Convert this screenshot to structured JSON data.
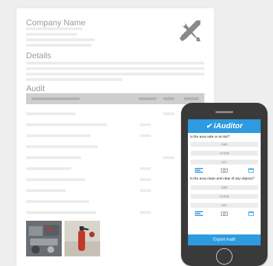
{
  "document": {
    "company_name": "Company Name",
    "details_heading": "Details",
    "audit_heading": "Audit",
    "icon_name": "tools-icon"
  },
  "phone": {
    "app_title": "iAuditor",
    "questions": [
      {
        "text": "Is the area safe or at risk?",
        "options": [
          "Safe",
          "At Risk",
          "N/A"
        ]
      },
      {
        "text": "Is the area clean and clear of any objects?",
        "options": [
          "Safe",
          "At Risk",
          "N/A"
        ]
      }
    ],
    "export_label": "Export Audit",
    "accent_color": "#2e9be0"
  }
}
